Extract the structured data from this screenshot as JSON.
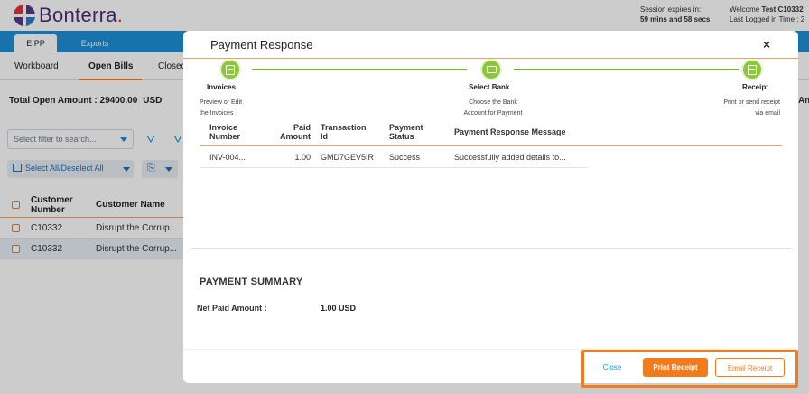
{
  "brand": {
    "name": "Bonterra",
    "suffix": "."
  },
  "session": {
    "label": "Session expires in:",
    "remaining": "59 mins and 58 secs"
  },
  "user": {
    "welcome_prefix": "Welcome",
    "name": "Test C10332",
    "last_logged_label": "Last Logged in Time : 2"
  },
  "tabs": [
    {
      "label": "EIPP"
    },
    {
      "label": "Exports"
    }
  ],
  "subtabs": [
    {
      "label": "Workboard"
    },
    {
      "label": "Open Bills"
    },
    {
      "label": "Closed"
    }
  ],
  "totals": {
    "label": "Total Open Amount : 29400.00",
    "currency": "USD",
    "right_truncated": "Am"
  },
  "filter": {
    "placeholder": "Select filter to search..."
  },
  "select_all_label": "Select All/Deselect All",
  "grid": {
    "headers": {
      "customer_number": "Customer Number",
      "customer_name": "Customer Name"
    },
    "rows": [
      {
        "number": "C10332",
        "name": "Disrupt the Corrup..."
      },
      {
        "number": "C10332",
        "name": "Disrupt the Corrup..."
      }
    ]
  },
  "modal": {
    "title": "Payment Response",
    "close_symbol": "×",
    "steps": [
      {
        "label": "Invoices",
        "desc_line1": "Preview or Edit",
        "desc_line2": "the Invoices"
      },
      {
        "label": "Select Bank",
        "desc_line1": "Choose the Bank",
        "desc_line2": "Account for Payment"
      },
      {
        "label": "Receipt",
        "desc_line1": "Print or send receipt",
        "desc_line2": "via email"
      }
    ],
    "table": {
      "headers": {
        "invoice": "Invoice Number",
        "paid": "Paid Amount",
        "txn": "Transaction Id",
        "status": "Payment Status",
        "message": "Payment Response Message"
      },
      "rows": [
        {
          "invoice": "INV-004...",
          "paid": "1.00",
          "txn": "GMD7GEV5IR",
          "status": "Success",
          "message": "Successfully added details to..."
        }
      ]
    },
    "summary": {
      "title": "PAYMENT SUMMARY",
      "net_label": "Net Paid Amount :",
      "net_value": "1.00 USD"
    },
    "buttons": {
      "close": "Close",
      "print": "Print Receipt",
      "email": "Email Receipt"
    }
  },
  "colors": {
    "accent_orange": "#f07c1e",
    "step_green": "#8cc63f",
    "tab_blue": "#1f8fd6"
  },
  "icons": [
    "invoice-icon",
    "bank-card-icon",
    "receipt-icon",
    "filter-icon",
    "export-icon",
    "close-icon"
  ]
}
